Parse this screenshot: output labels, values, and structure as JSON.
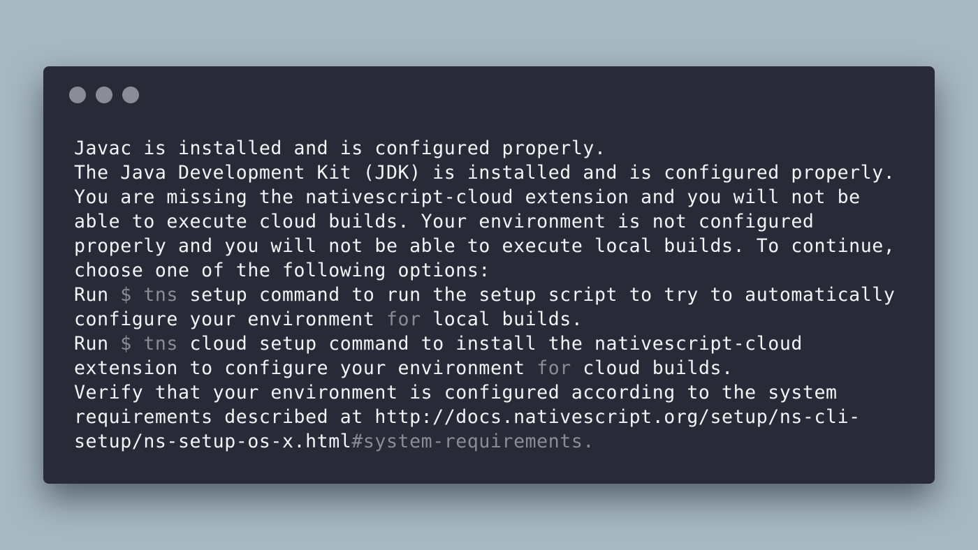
{
  "window": {
    "controls": [
      "close",
      "minimize",
      "zoom"
    ],
    "colors": {
      "background": "#a7b8c3",
      "terminal": "#282b37",
      "text": "#f3f4f6",
      "muted": "#8a8d96"
    }
  },
  "terminal": {
    "lines": [
      [
        {
          "t": "Javac is installed and is configured properly.",
          "m": false
        }
      ],
      [
        {
          "t": "The Java Development Kit (JDK) is installed and is configured properly.",
          "m": false
        }
      ],
      [
        {
          "t": "You are missing the nativescript-cloud extension and you will not be",
          "m": false
        }
      ],
      [
        {
          "t": "able to execute cloud builds. Your environment is not configured",
          "m": false
        }
      ],
      [
        {
          "t": "properly and you will not be able to execute local builds. To continue,",
          "m": false
        }
      ],
      [
        {
          "t": "choose one of the following options:",
          "m": false
        }
      ],
      [
        {
          "t": "Run ",
          "m": false
        },
        {
          "t": "$ tns",
          "m": true
        },
        {
          "t": " setup command to run the setup script to try to automatically",
          "m": false
        }
      ],
      [
        {
          "t": "configure your environment ",
          "m": false
        },
        {
          "t": "for",
          "m": true
        },
        {
          "t": " local builds.",
          "m": false
        }
      ],
      [
        {
          "t": "Run ",
          "m": false
        },
        {
          "t": "$ tns",
          "m": true
        },
        {
          "t": " cloud setup command to install the nativescript-cloud",
          "m": false
        }
      ],
      [
        {
          "t": "extension to configure your environment ",
          "m": false
        },
        {
          "t": "for",
          "m": true
        },
        {
          "t": " cloud builds.",
          "m": false
        }
      ],
      [
        {
          "t": "Verify that your environment is configured according to the system",
          "m": false
        }
      ],
      [
        {
          "t": "requirements described at http://docs.nativescript.org/setup/ns-cli-",
          "m": false
        }
      ],
      [
        {
          "t": "setup/ns-setup-os-x.html",
          "m": false
        },
        {
          "t": "#system-requirements.",
          "m": true
        }
      ]
    ]
  }
}
